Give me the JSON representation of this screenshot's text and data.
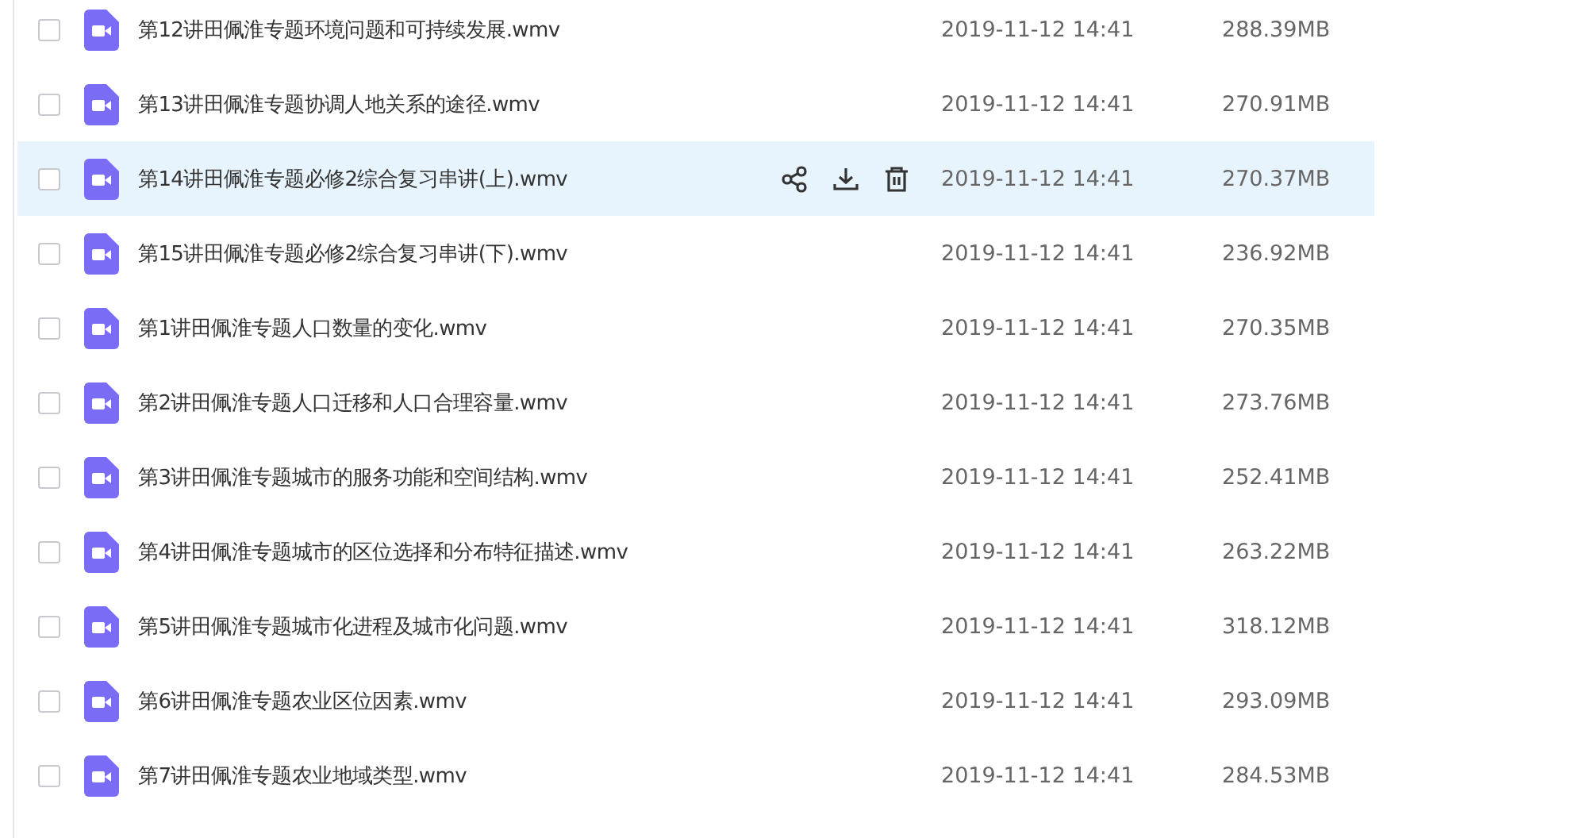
{
  "files": [
    {
      "name": "第12讲田佩淮专题环境问题和可持续发展.wmv",
      "modified": "2019-11-12 14:41",
      "size": "288.39MB",
      "checked": false,
      "highlighted": false
    },
    {
      "name": "第13讲田佩淮专题协调人地关系的途径.wmv",
      "modified": "2019-11-12 14:41",
      "size": "270.91MB",
      "checked": false,
      "highlighted": false
    },
    {
      "name": "第14讲田佩淮专题必修2综合复习串讲(上).wmv",
      "modified": "2019-11-12 14:41",
      "size": "270.37MB",
      "checked": false,
      "highlighted": true
    },
    {
      "name": "第15讲田佩淮专题必修2综合复习串讲(下).wmv",
      "modified": "2019-11-12 14:41",
      "size": "236.92MB",
      "checked": false,
      "highlighted": false
    },
    {
      "name": "第1讲田佩淮专题人口数量的变化.wmv",
      "modified": "2019-11-12 14:41",
      "size": "270.35MB",
      "checked": false,
      "highlighted": false
    },
    {
      "name": "第2讲田佩淮专题人口迁移和人口合理容量.wmv",
      "modified": "2019-11-12 14:41",
      "size": "273.76MB",
      "checked": false,
      "highlighted": false
    },
    {
      "name": "第3讲田佩淮专题城市的服务功能和空间结构.wmv",
      "modified": "2019-11-12 14:41",
      "size": "252.41MB",
      "checked": false,
      "highlighted": false
    },
    {
      "name": "第4讲田佩淮专题城市的区位选择和分布特征描述.wmv",
      "modified": "2019-11-12 14:41",
      "size": "263.22MB",
      "checked": false,
      "highlighted": false
    },
    {
      "name": "第5讲田佩淮专题城市化进程及城市化问题.wmv",
      "modified": "2019-11-12 14:41",
      "size": "318.12MB",
      "checked": false,
      "highlighted": false
    },
    {
      "name": "第6讲田佩淮专题农业区位因素.wmv",
      "modified": "2019-11-12 14:41",
      "size": "293.09MB",
      "checked": false,
      "highlighted": false
    },
    {
      "name": "第7讲田佩淮专题农业地域类型.wmv",
      "modified": "2019-11-12 14:41",
      "size": "284.53MB",
      "checked": false,
      "highlighted": false
    }
  ]
}
